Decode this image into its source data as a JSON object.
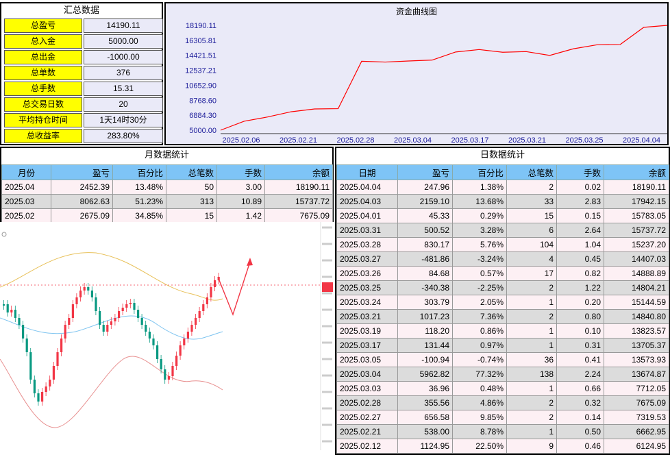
{
  "summary": {
    "title": "汇总数据",
    "rows": [
      {
        "label": "总盈亏",
        "value": "14190.11"
      },
      {
        "label": "总入金",
        "value": "5000.00"
      },
      {
        "label": "总出金",
        "value": "-1000.00"
      },
      {
        "label": "总单数",
        "value": "376"
      },
      {
        "label": "总手数",
        "value": "15.31"
      },
      {
        "label": "总交易日数",
        "value": "20"
      },
      {
        "label": "平均持仓时间",
        "value": "1天14时30分"
      },
      {
        "label": "总收益率",
        "value": "283.80%"
      }
    ]
  },
  "chart_data": {
    "type": "line",
    "title": "资金曲线图",
    "y_ticks": [
      "18190.11",
      "16305.81",
      "14421.51",
      "12537.21",
      "10652.90",
      "8768.60",
      "6884.30",
      "5000.00"
    ],
    "x_ticks": [
      "2025.02.06",
      "2025.02.21",
      "2025.02.28",
      "2025.03.04",
      "2025.03.17",
      "2025.03.21",
      "2025.03.25",
      "2025.04.04"
    ],
    "ylim": [
      5000.0,
      18190.11
    ],
    "series": [
      {
        "values": [
          5000.0,
          6124.95,
          6662.95,
          7319.53,
          7675.09,
          7712.05,
          13674.87,
          13573.93,
          13705.37,
          13823.57,
          14840.8,
          15144.59,
          14804.21,
          14888.89,
          14407.03,
          15237.2,
          15737.72,
          15783.05,
          17942.15,
          18190.11
        ]
      }
    ],
    "color": "#ff0000",
    "grid": false
  },
  "monthly": {
    "title": "月数据统计",
    "headers": [
      "月份",
      "盈亏",
      "百分比",
      "总笔数",
      "手数",
      "余额"
    ],
    "rows": [
      [
        "2025.04",
        "2452.39",
        "13.48%",
        "50",
        "3.00",
        "18190.11"
      ],
      [
        "2025.03",
        "8062.63",
        "51.23%",
        "313",
        "10.89",
        "15737.72"
      ],
      [
        "2025.02",
        "2675.09",
        "34.85%",
        "15",
        "1.42",
        "7675.09"
      ]
    ]
  },
  "daily": {
    "title": "日数据统计",
    "headers": [
      "日期",
      "盈亏",
      "百分比",
      "总笔数",
      "手数",
      "余额"
    ],
    "rows": [
      [
        "2025.04.04",
        "247.96",
        "1.38%",
        "2",
        "0.02",
        "18190.11"
      ],
      [
        "2025.04.03",
        "2159.10",
        "13.68%",
        "33",
        "2.83",
        "17942.15"
      ],
      [
        "2025.04.01",
        "45.33",
        "0.29%",
        "15",
        "0.15",
        "15783.05"
      ],
      [
        "2025.03.31",
        "500.52",
        "3.28%",
        "6",
        "2.64",
        "15737.72"
      ],
      [
        "2025.03.28",
        "830.17",
        "5.76%",
        "104",
        "1.04",
        "15237.20"
      ],
      [
        "2025.03.27",
        "-481.86",
        "-3.24%",
        "4",
        "0.45",
        "14407.03"
      ],
      [
        "2025.03.26",
        "84.68",
        "0.57%",
        "17",
        "0.82",
        "14888.89"
      ],
      [
        "2025.03.25",
        "-340.38",
        "-2.25%",
        "2",
        "1.22",
        "14804.21"
      ],
      [
        "2025.03.24",
        "303.79",
        "2.05%",
        "1",
        "0.20",
        "15144.59"
      ],
      [
        "2025.03.21",
        "1017.23",
        "7.36%",
        "2",
        "0.80",
        "14840.80"
      ],
      [
        "2025.03.19",
        "118.20",
        "0.86%",
        "1",
        "0.10",
        "13823.57"
      ],
      [
        "2025.03.17",
        "131.44",
        "0.97%",
        "1",
        "0.31",
        "13705.37"
      ],
      [
        "2025.03.05",
        "-100.94",
        "-0.74%",
        "36",
        "0.41",
        "13573.93"
      ],
      [
        "2025.03.04",
        "5962.82",
        "77.32%",
        "138",
        "2.24",
        "13674.87"
      ],
      [
        "2025.03.03",
        "36.96",
        "0.48%",
        "1",
        "0.66",
        "7712.05"
      ],
      [
        "2025.02.28",
        "355.56",
        "4.86%",
        "2",
        "0.32",
        "7675.09"
      ],
      [
        "2025.02.27",
        "656.58",
        "9.85%",
        "2",
        "0.14",
        "7319.53"
      ],
      [
        "2025.02.21",
        "538.00",
        "8.78%",
        "1",
        "0.50",
        "6662.95"
      ],
      [
        "2025.02.12",
        "1124.95",
        "22.50%",
        "9",
        "0.46",
        "6124.95"
      ]
    ]
  },
  "candle_chart": {
    "up_color": "#f23645",
    "down_color": "#089981",
    "band_upper_color": "#e8c15a",
    "band_mid_color": "#7ec4f0",
    "band_lower_color": "#e89090"
  }
}
